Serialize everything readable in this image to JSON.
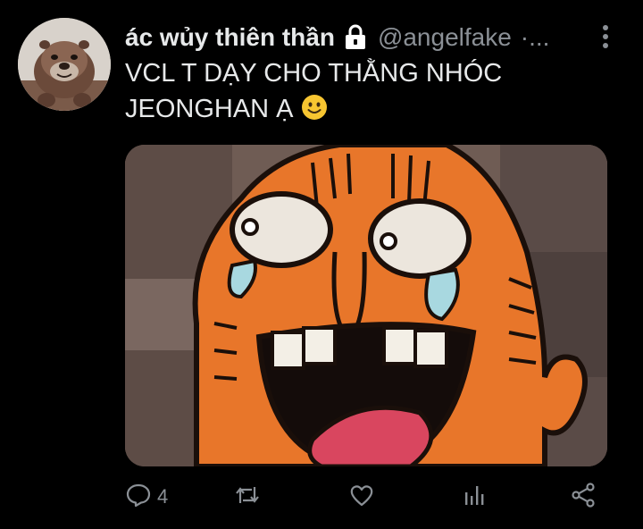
{
  "tweet": {
    "display_name": "ác wủy thiên thần",
    "handle": "@angelfake",
    "dots": "·...",
    "text_line1": "VCL T DẠY CHO THẰNG NHÓC",
    "text_line2": "JEONGHAN Ạ",
    "emoji": "🙂",
    "reply_count": "4",
    "icons": {
      "lock": "lock-icon",
      "more": "more-vertical-icon",
      "reply": "reply-icon",
      "retweet": "retweet-icon",
      "like": "heart-icon",
      "analytics": "analytics-icon",
      "share": "share-icon"
    }
  },
  "colors": {
    "background": "#000000",
    "text": "#e7e9ea",
    "muted": "#8b9096",
    "emoji_yellow": "#f7c531"
  }
}
